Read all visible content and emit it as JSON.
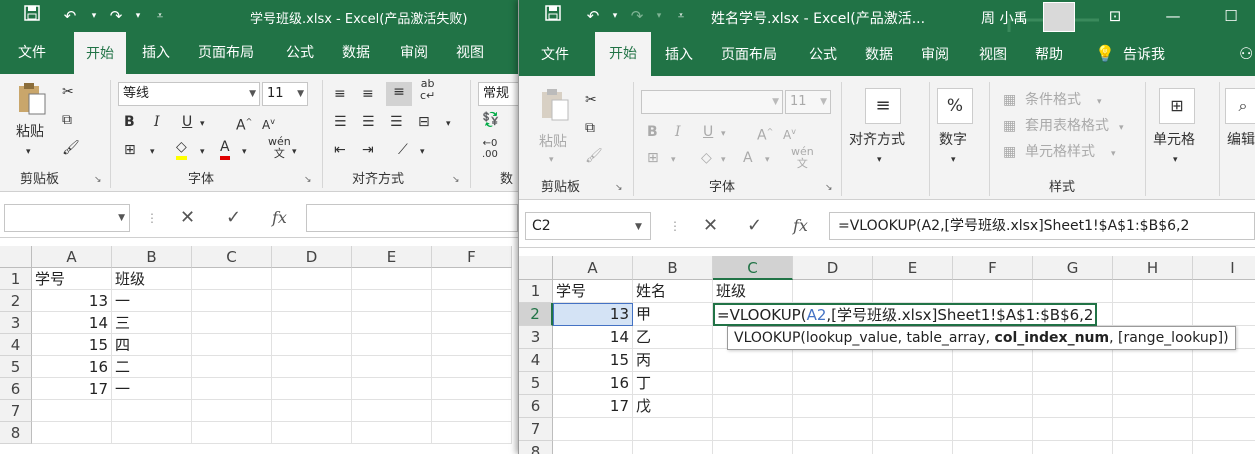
{
  "left": {
    "title": "学号班级.xlsx  -  Excel(产品激活失败)",
    "tabs": [
      "文件",
      "开始",
      "插入",
      "页面布局",
      "公式",
      "数据",
      "审阅",
      "视图"
    ],
    "ribbon": {
      "paste": "粘贴",
      "font_name": "等线",
      "font_size": "11",
      "number_format": "常规",
      "groups": {
        "clipboard": "剪贴板",
        "font": "字体",
        "align": "对齐方式",
        "number": "数"
      }
    },
    "fx": "fx",
    "columns": [
      "A",
      "B",
      "C",
      "D",
      "E",
      "F"
    ],
    "rows": [
      "1",
      "2",
      "3",
      "4",
      "5",
      "6",
      "7",
      "8"
    ],
    "cells": [
      [
        "学号",
        "班级"
      ],
      [
        "13",
        "一"
      ],
      [
        "14",
        "三"
      ],
      [
        "15",
        "四"
      ],
      [
        "16",
        "二"
      ],
      [
        "17",
        "一"
      ]
    ]
  },
  "right": {
    "title": "姓名学号.xlsx  -  Excel(产品激活...",
    "user": "周 小禹",
    "tabs": [
      "文件",
      "开始",
      "插入",
      "页面布局",
      "公式",
      "数据",
      "审阅",
      "视图",
      "帮助",
      "告诉我"
    ],
    "ribbon": {
      "paste": "粘贴",
      "font_size": "11",
      "align": "对齐方式",
      "number": "数字",
      "percent": "%",
      "cond_format": "条件格式",
      "table_format": "套用表格格式",
      "cell_style": "单元格样式",
      "cells": "单元格",
      "edit": "编辑",
      "groups": {
        "clipboard": "剪贴板",
        "font": "字体",
        "styles": "样式"
      }
    },
    "name_box": "C2",
    "fx": "fx",
    "formula": "=VLOOKUP(A2,[学号班级.xlsx]Sheet1!$A$1:$B$6,2",
    "edit_cell": {
      "prefix": "=VLOOKUP(",
      "ref": "A2",
      "suffix": ",[学号班级.xlsx]Sheet1!$A$1:$B$6,2"
    },
    "tooltip": {
      "a": "VLOOKUP(lookup_value, table_array, ",
      "b": "col_index_num",
      ",c": "",
      "c": ", [range_lookup])"
    },
    "columns": [
      "A",
      "B",
      "C",
      "D",
      "E",
      "F",
      "G",
      "H",
      "I"
    ],
    "rows": [
      "1",
      "2",
      "3",
      "4",
      "5",
      "6",
      "7",
      "8"
    ],
    "cells": [
      [
        "学号",
        "姓名",
        "班级"
      ],
      [
        "13",
        "甲"
      ],
      [
        "14",
        "乙"
      ],
      [
        "15",
        "丙"
      ],
      [
        "16",
        "丁"
      ],
      [
        "17",
        "戊"
      ]
    ]
  }
}
